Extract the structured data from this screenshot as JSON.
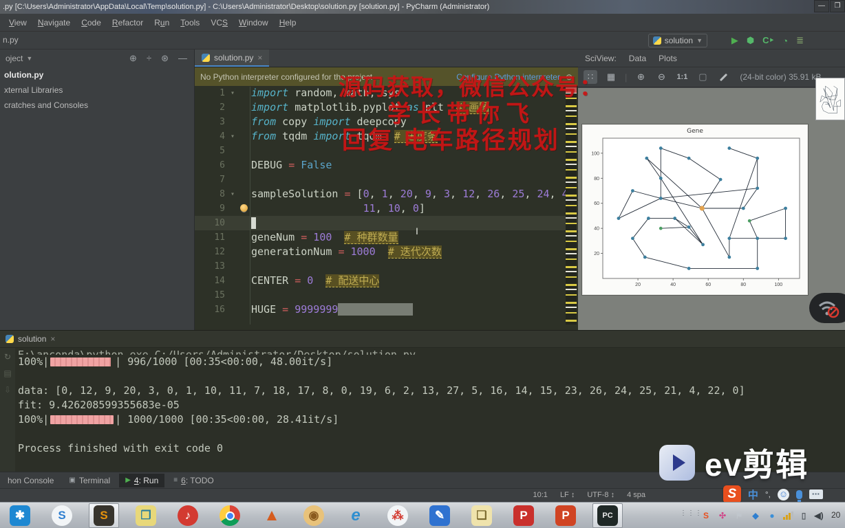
{
  "window": {
    "title": ".py [C:\\Users\\Administrator\\AppData\\Local\\Temp\\solution.py] - C:\\Users\\Administrator\\Desktop\\solution.py [solution.py] - PyCharm (Administrator)",
    "controls": {
      "minimize": "—",
      "maximize": "❐",
      "close": "✕"
    }
  },
  "menubar": {
    "items": [
      {
        "label": "View",
        "u": 0
      },
      {
        "label": "Navigate",
        "u": 0
      },
      {
        "label": "Code",
        "u": 0
      },
      {
        "label": "Refactor",
        "u": 0
      },
      {
        "label": "Run",
        "u": 1
      },
      {
        "label": "Tools",
        "u": 0
      },
      {
        "label": "VCS",
        "u": 2
      },
      {
        "label": "Window",
        "u": 0
      },
      {
        "label": "Help",
        "u": 0
      }
    ]
  },
  "navbar": {
    "breadcrumb": "n.py",
    "run_config": "solution"
  },
  "project_panel": {
    "header": "oject",
    "items": [
      {
        "label": "olution.py",
        "bold": true
      },
      {
        "label": "xternal Libraries",
        "bold": false
      },
      {
        "label": "cratches and Consoles",
        "bold": false
      }
    ]
  },
  "editor": {
    "tab_label": "solution.py",
    "close_glyph": "×",
    "warning": {
      "text": "No Python interpreter configured for the project",
      "action": "Configure Python interpreter"
    },
    "lines": [
      {
        "num": "1",
        "fold": "▾",
        "tokens": [
          {
            "c": "kw",
            "t": "import"
          },
          {
            "c": "pl",
            "t": " random, math, sys"
          }
        ]
      },
      {
        "num": "2",
        "tokens": [
          {
            "c": "kw",
            "t": "import"
          },
          {
            "c": "pl",
            "t": " matplotlib.pyplot "
          },
          {
            "c": "kw",
            "t": "as"
          },
          {
            "c": "pl",
            "t": " plt  "
          },
          {
            "c": "cmt",
            "t": "# 画图"
          }
        ]
      },
      {
        "num": "3",
        "tokens": [
          {
            "c": "kw",
            "t": "from"
          },
          {
            "c": "pl",
            "t": " copy "
          },
          {
            "c": "kw",
            "t": "import"
          },
          {
            "c": "pl",
            "t": " deepcopy"
          }
        ]
      },
      {
        "num": "4",
        "fold": "▾",
        "tokens": [
          {
            "c": "kw",
            "t": "from"
          },
          {
            "c": "pl",
            "t": " tqdm "
          },
          {
            "c": "kw",
            "t": "import"
          },
          {
            "c": "pl",
            "t": " tqdm  "
          },
          {
            "c": "cmt",
            "t": "# 进度条"
          }
        ]
      },
      {
        "num": "5",
        "tokens": []
      },
      {
        "num": "6",
        "tokens": [
          {
            "c": "pl",
            "t": "DEBUG "
          },
          {
            "c": "op",
            "t": "="
          },
          {
            "c": "bool",
            "t": " False"
          }
        ]
      },
      {
        "num": "7",
        "tokens": []
      },
      {
        "num": "8",
        "fold": "▾",
        "tokens": [
          {
            "c": "pl",
            "t": "sampleSolution "
          },
          {
            "c": "op",
            "t": "="
          },
          {
            "c": "pl",
            "t": " ["
          },
          {
            "c": "num",
            "t": "0"
          },
          {
            "c": "pl",
            "t": ", "
          },
          {
            "c": "num",
            "t": "1"
          },
          {
            "c": "pl",
            "t": ", "
          },
          {
            "c": "num",
            "t": "20"
          },
          {
            "c": "pl",
            "t": ", "
          },
          {
            "c": "num",
            "t": "9"
          },
          {
            "c": "pl",
            "t": ", "
          },
          {
            "c": "num",
            "t": "3"
          },
          {
            "c": "pl",
            "t": ", "
          },
          {
            "c": "num",
            "t": "12"
          },
          {
            "c": "pl",
            "t": ", "
          },
          {
            "c": "num",
            "t": "26"
          },
          {
            "c": "pl",
            "t": ", "
          },
          {
            "c": "num",
            "t": "25"
          },
          {
            "c": "pl",
            "t": ", "
          },
          {
            "c": "num",
            "t": "24"
          },
          {
            "c": "pl",
            "t": ", "
          },
          {
            "c": "num",
            "t": "4"
          },
          {
            "c": "pl",
            "t": ","
          }
        ]
      },
      {
        "num": "9",
        "bulb": true,
        "tokens": [
          {
            "c": "pl",
            "t": "                  "
          },
          {
            "c": "num",
            "t": "11"
          },
          {
            "c": "pl",
            "t": ", "
          },
          {
            "c": "num",
            "t": "10"
          },
          {
            "c": "pl",
            "t": ", "
          },
          {
            "c": "num",
            "t": "0"
          },
          {
            "c": "pl",
            "t": "]"
          }
        ]
      },
      {
        "num": "10",
        "active": true,
        "cursor": true,
        "tokens": []
      },
      {
        "num": "11",
        "tokens": [
          {
            "c": "pl",
            "t": "geneNum "
          },
          {
            "c": "op",
            "t": "="
          },
          {
            "c": "num",
            "t": " 100"
          },
          {
            "c": "pl",
            "t": "  "
          },
          {
            "c": "cmt",
            "t": "# 种群数量"
          }
        ]
      },
      {
        "num": "12",
        "tokens": [
          {
            "c": "pl",
            "t": "generationNum "
          },
          {
            "c": "op",
            "t": "="
          },
          {
            "c": "num",
            "t": " 1000"
          },
          {
            "c": "pl",
            "t": "  "
          },
          {
            "c": "cmt",
            "t": "# 迭代次数"
          }
        ]
      },
      {
        "num": "13",
        "tokens": []
      },
      {
        "num": "14",
        "tokens": [
          {
            "c": "pl",
            "t": "CENTER "
          },
          {
            "c": "op",
            "t": "="
          },
          {
            "c": "num",
            "t": " 0"
          },
          {
            "c": "pl",
            "t": "  "
          },
          {
            "c": "cmt",
            "t": "# 配送中心"
          }
        ]
      },
      {
        "num": "15",
        "tokens": []
      },
      {
        "num": "16",
        "tokens": [
          {
            "c": "pl",
            "t": "HUGE "
          },
          {
            "c": "op",
            "t": "="
          },
          {
            "c": "num",
            "t": " 9999999"
          },
          {
            "c": "sel",
            "t": "            "
          }
        ]
      }
    ]
  },
  "sciview": {
    "label": "SciView:",
    "tabs": [
      "Data",
      "Plots"
    ],
    "zoom_label": "1:1",
    "info": "(24-bit color) 35.91 kB"
  },
  "chart_data": {
    "type": "scatter",
    "title": "Gene",
    "xlabel": "",
    "ylabel": "",
    "xlim": [
      0,
      112
    ],
    "ylim": [
      0,
      112
    ],
    "xticks": [
      20,
      40,
      60,
      80,
      100
    ],
    "yticks": [
      20,
      40,
      60,
      80,
      100
    ],
    "legend": null,
    "grid": false,
    "point_colors": {
      "b": "#3d7f9e",
      "g": "#4d9e64",
      "o": "#e2a24f"
    },
    "points": [
      [
        56.5,
        56,
        "o"
      ],
      [
        33,
        104,
        "b"
      ],
      [
        25,
        96,
        "b"
      ],
      [
        49,
        96,
        "b"
      ],
      [
        67,
        79,
        "b"
      ],
      [
        33,
        80,
        "b"
      ],
      [
        17,
        70,
        "b"
      ],
      [
        9,
        48,
        "b"
      ],
      [
        33,
        64,
        "b"
      ],
      [
        41,
        48,
        "b"
      ],
      [
        26,
        48,
        "b"
      ],
      [
        17,
        32,
        "b"
      ],
      [
        49,
        41,
        "b"
      ],
      [
        33,
        40,
        "g"
      ],
      [
        57,
        27,
        "b"
      ],
      [
        24,
        17,
        "b"
      ],
      [
        49,
        8,
        "b"
      ],
      [
        72,
        104,
        "b"
      ],
      [
        88,
        96,
        "b"
      ],
      [
        88,
        72,
        "b"
      ],
      [
        80,
        56,
        "b"
      ],
      [
        72,
        32,
        "b"
      ],
      [
        88,
        32,
        "b"
      ],
      [
        104,
        32,
        "b"
      ],
      [
        104,
        56,
        "b"
      ],
      [
        83.5,
        46,
        "g"
      ],
      [
        72,
        17,
        "b"
      ],
      [
        88,
        8,
        "b"
      ]
    ],
    "segments": [
      [
        1,
        8
      ],
      [
        1,
        3
      ],
      [
        3,
        4
      ],
      [
        4,
        0
      ],
      [
        2,
        5
      ],
      [
        5,
        14
      ],
      [
        2,
        0
      ],
      [
        6,
        7
      ],
      [
        7,
        8
      ],
      [
        6,
        8
      ],
      [
        0,
        8
      ],
      [
        0,
        20
      ],
      [
        0,
        26
      ],
      [
        9,
        12
      ],
      [
        10,
        9
      ],
      [
        13,
        12
      ],
      [
        12,
        14
      ],
      [
        9,
        14
      ],
      [
        10,
        11
      ],
      [
        11,
        15
      ],
      [
        15,
        16
      ],
      [
        16,
        27
      ],
      [
        26,
        21
      ],
      [
        21,
        22
      ],
      [
        22,
        23
      ],
      [
        23,
        24
      ],
      [
        24,
        25
      ],
      [
        25,
        22
      ],
      [
        22,
        27
      ],
      [
        17,
        18
      ],
      [
        18,
        19
      ],
      [
        19,
        20
      ],
      [
        19,
        8
      ],
      [
        18,
        21
      ]
    ]
  },
  "console": {
    "tab_label": "solution",
    "close_glyph": "×",
    "lines": [
      {
        "t": "cmd",
        "text": "E:\\anconda\\python.exe C:/Users/Administrator/Desktop/solution.py"
      },
      {
        "t": "progress",
        "pct": "100%|",
        "frac": "| 996/1000 [00:35<00:00, 48.00it/s]",
        "fill": 0.96
      },
      {
        "t": "blank"
      },
      {
        "t": "text",
        "text": "data: [0, 12, 9, 20, 3, 0, 1, 10, 11, 7, 18, 17, 8, 0, 19, 6, 2, 13, 27, 5, 16, 14, 15, 23, 26, 24, 25, 21, 4, 22, 0]"
      },
      {
        "t": "text",
        "text": "fit: 9.426208599355683e-05"
      },
      {
        "t": "progress",
        "pct": "100%|",
        "frac": "| 1000/1000 [00:35<00:00, 28.41it/s]",
        "fill": 1
      },
      {
        "t": "blank"
      },
      {
        "t": "text",
        "text": "Process finished with exit code 0"
      }
    ]
  },
  "tool_tabs": [
    {
      "label": "hon Console",
      "icon": "",
      "active": false,
      "u": -1
    },
    {
      "label": "Terminal",
      "icon": "▣",
      "active": false,
      "u": -1
    },
    {
      "label": "4: Run",
      "icon": "▶",
      "active": true,
      "u": 0
    },
    {
      "label": "6: TODO",
      "icon": "≡",
      "active": false,
      "u": 0
    }
  ],
  "status_bar": {
    "position": "10:1",
    "line_sep": "LF ↕",
    "encoding": "UTF-8 ↕",
    "indent": "4 spa"
  },
  "ime_bar": {
    "s": "S",
    "zh": "中",
    "sym": "°,",
    "smile": "☺"
  },
  "taskbar": {
    "clock": "20",
    "items": [
      {
        "name": "qq",
        "glyph": "✱",
        "bg": "#1e88d2",
        "fg": "#ffffff",
        "active": false
      },
      {
        "name": "sogou-browser",
        "glyph": "S",
        "bg": "#f2f5f7",
        "fg": "#2f7fd0",
        "active": false,
        "round": true
      },
      {
        "name": "sublime-text",
        "glyph": "S",
        "bg": "#37342d",
        "fg": "#e8930c",
        "active": true
      },
      {
        "name": "vmware",
        "glyph": "❐",
        "bg": "#e8d87a",
        "fg": "#2e7f9e",
        "active": false
      },
      {
        "name": "netease-music",
        "glyph": "♪",
        "bg": "#d33a31",
        "fg": "#ffffff",
        "active": false,
        "round": true
      },
      {
        "name": "chrome",
        "glyph": "",
        "bg": "chrome",
        "fg": "#fff",
        "active": false,
        "round": true
      },
      {
        "name": "matlab",
        "glyph": "▲",
        "bg": "none",
        "fg": "#d55c1e",
        "active": false
      },
      {
        "name": "monkey-app",
        "glyph": "◉",
        "bg": "#e8c27a",
        "fg": "#8a5a1e",
        "active": false,
        "round": true
      },
      {
        "name": "internet-explorer",
        "glyph": "e",
        "bg": "none",
        "fg": "#2f8fd0",
        "active": false
      },
      {
        "name": "tri-circle-app",
        "glyph": "⁂",
        "bg": "#f2f5f7",
        "fg": "#d33a31",
        "active": false,
        "round": true
      },
      {
        "name": "notes-app",
        "glyph": "✎",
        "bg": "#2f72d0",
        "fg": "#ffffff",
        "active": false
      },
      {
        "name": "file-explorer",
        "glyph": "❏",
        "bg": "#efe3ac",
        "fg": "#7a6a2e",
        "active": false
      },
      {
        "name": "pdf-app",
        "glyph": "P",
        "bg": "#c9302c",
        "fg": "#ffffff",
        "active": false
      },
      {
        "name": "powerpoint",
        "glyph": "P",
        "bg": "#d04423",
        "fg": "#ffffff",
        "active": false
      },
      {
        "name": "pycharm",
        "glyph": "PC",
        "bg": "#1f2826",
        "fg": "#eaeaea",
        "active": true
      }
    ],
    "tray": [
      {
        "name": "sogou-tray",
        "glyph": "S",
        "fg": "#e94f1e"
      },
      {
        "name": "flower-tray",
        "glyph": "✣",
        "fg": "#d0488a"
      },
      {
        "name": "flag-tray",
        "glyph": "⚑",
        "fg": "#c0c6cc"
      },
      {
        "name": "shield-tray",
        "glyph": "◆",
        "fg": "#2f7fd0"
      },
      {
        "name": "drop-tray",
        "glyph": "●",
        "fg": "#3a8fd8"
      }
    ]
  },
  "watermark": {
    "line1": "源码获取，微信公众号：",
    "line2": "学长带你飞",
    "line3": "回复 电车路径规划",
    "logo_text": "ev剪辑"
  },
  "colors": {
    "accent_blue": "#4a88c7",
    "warn_bg": "#55532a",
    "link": "#5e9bdc",
    "progress_pink": "#f0a3a3",
    "watermark_red": "#ca1616",
    "run_green": "#4faf50"
  }
}
